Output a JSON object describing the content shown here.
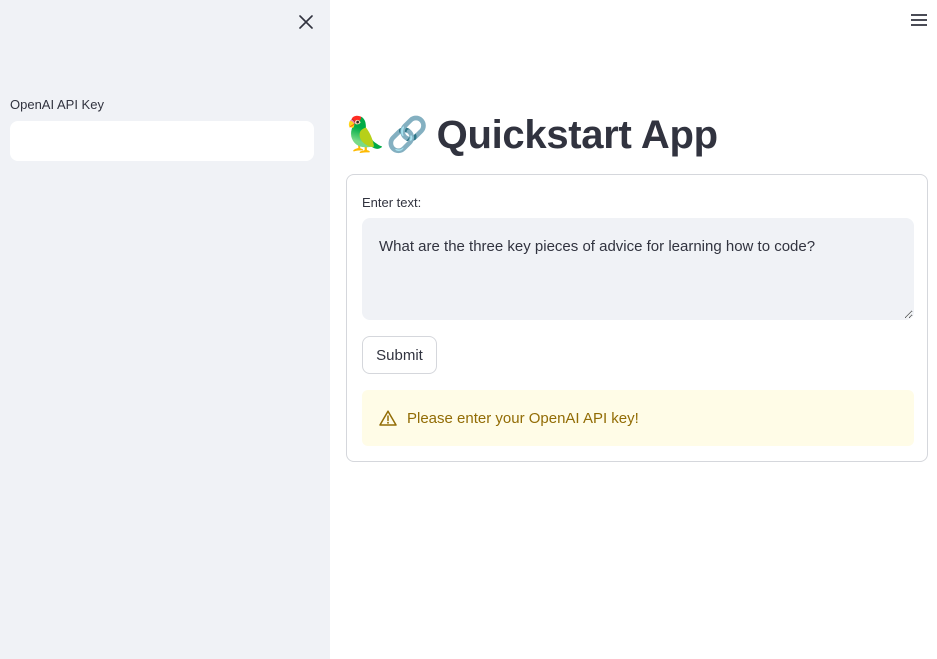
{
  "sidebar": {
    "close_icon": "close-icon",
    "api_key_label": "OpenAI API Key",
    "api_key_value": ""
  },
  "header": {
    "menu_icon": "hamburger-menu-icon"
  },
  "main": {
    "title_emoji": "🦜🔗",
    "title": "Quickstart App",
    "form": {
      "input_label": "Enter text:",
      "input_value": "What are the three key pieces of advice for learning how to code?",
      "submit_label": "Submit",
      "warning_icon": "warning-icon",
      "warning_text": "Please enter your OpenAI API key!"
    }
  },
  "colors": {
    "sidebar_bg": "#f0f2f6",
    "text": "#31333f",
    "warning_bg": "#fffce7",
    "warning_text": "#926c05",
    "border": "#d5d7dc"
  }
}
